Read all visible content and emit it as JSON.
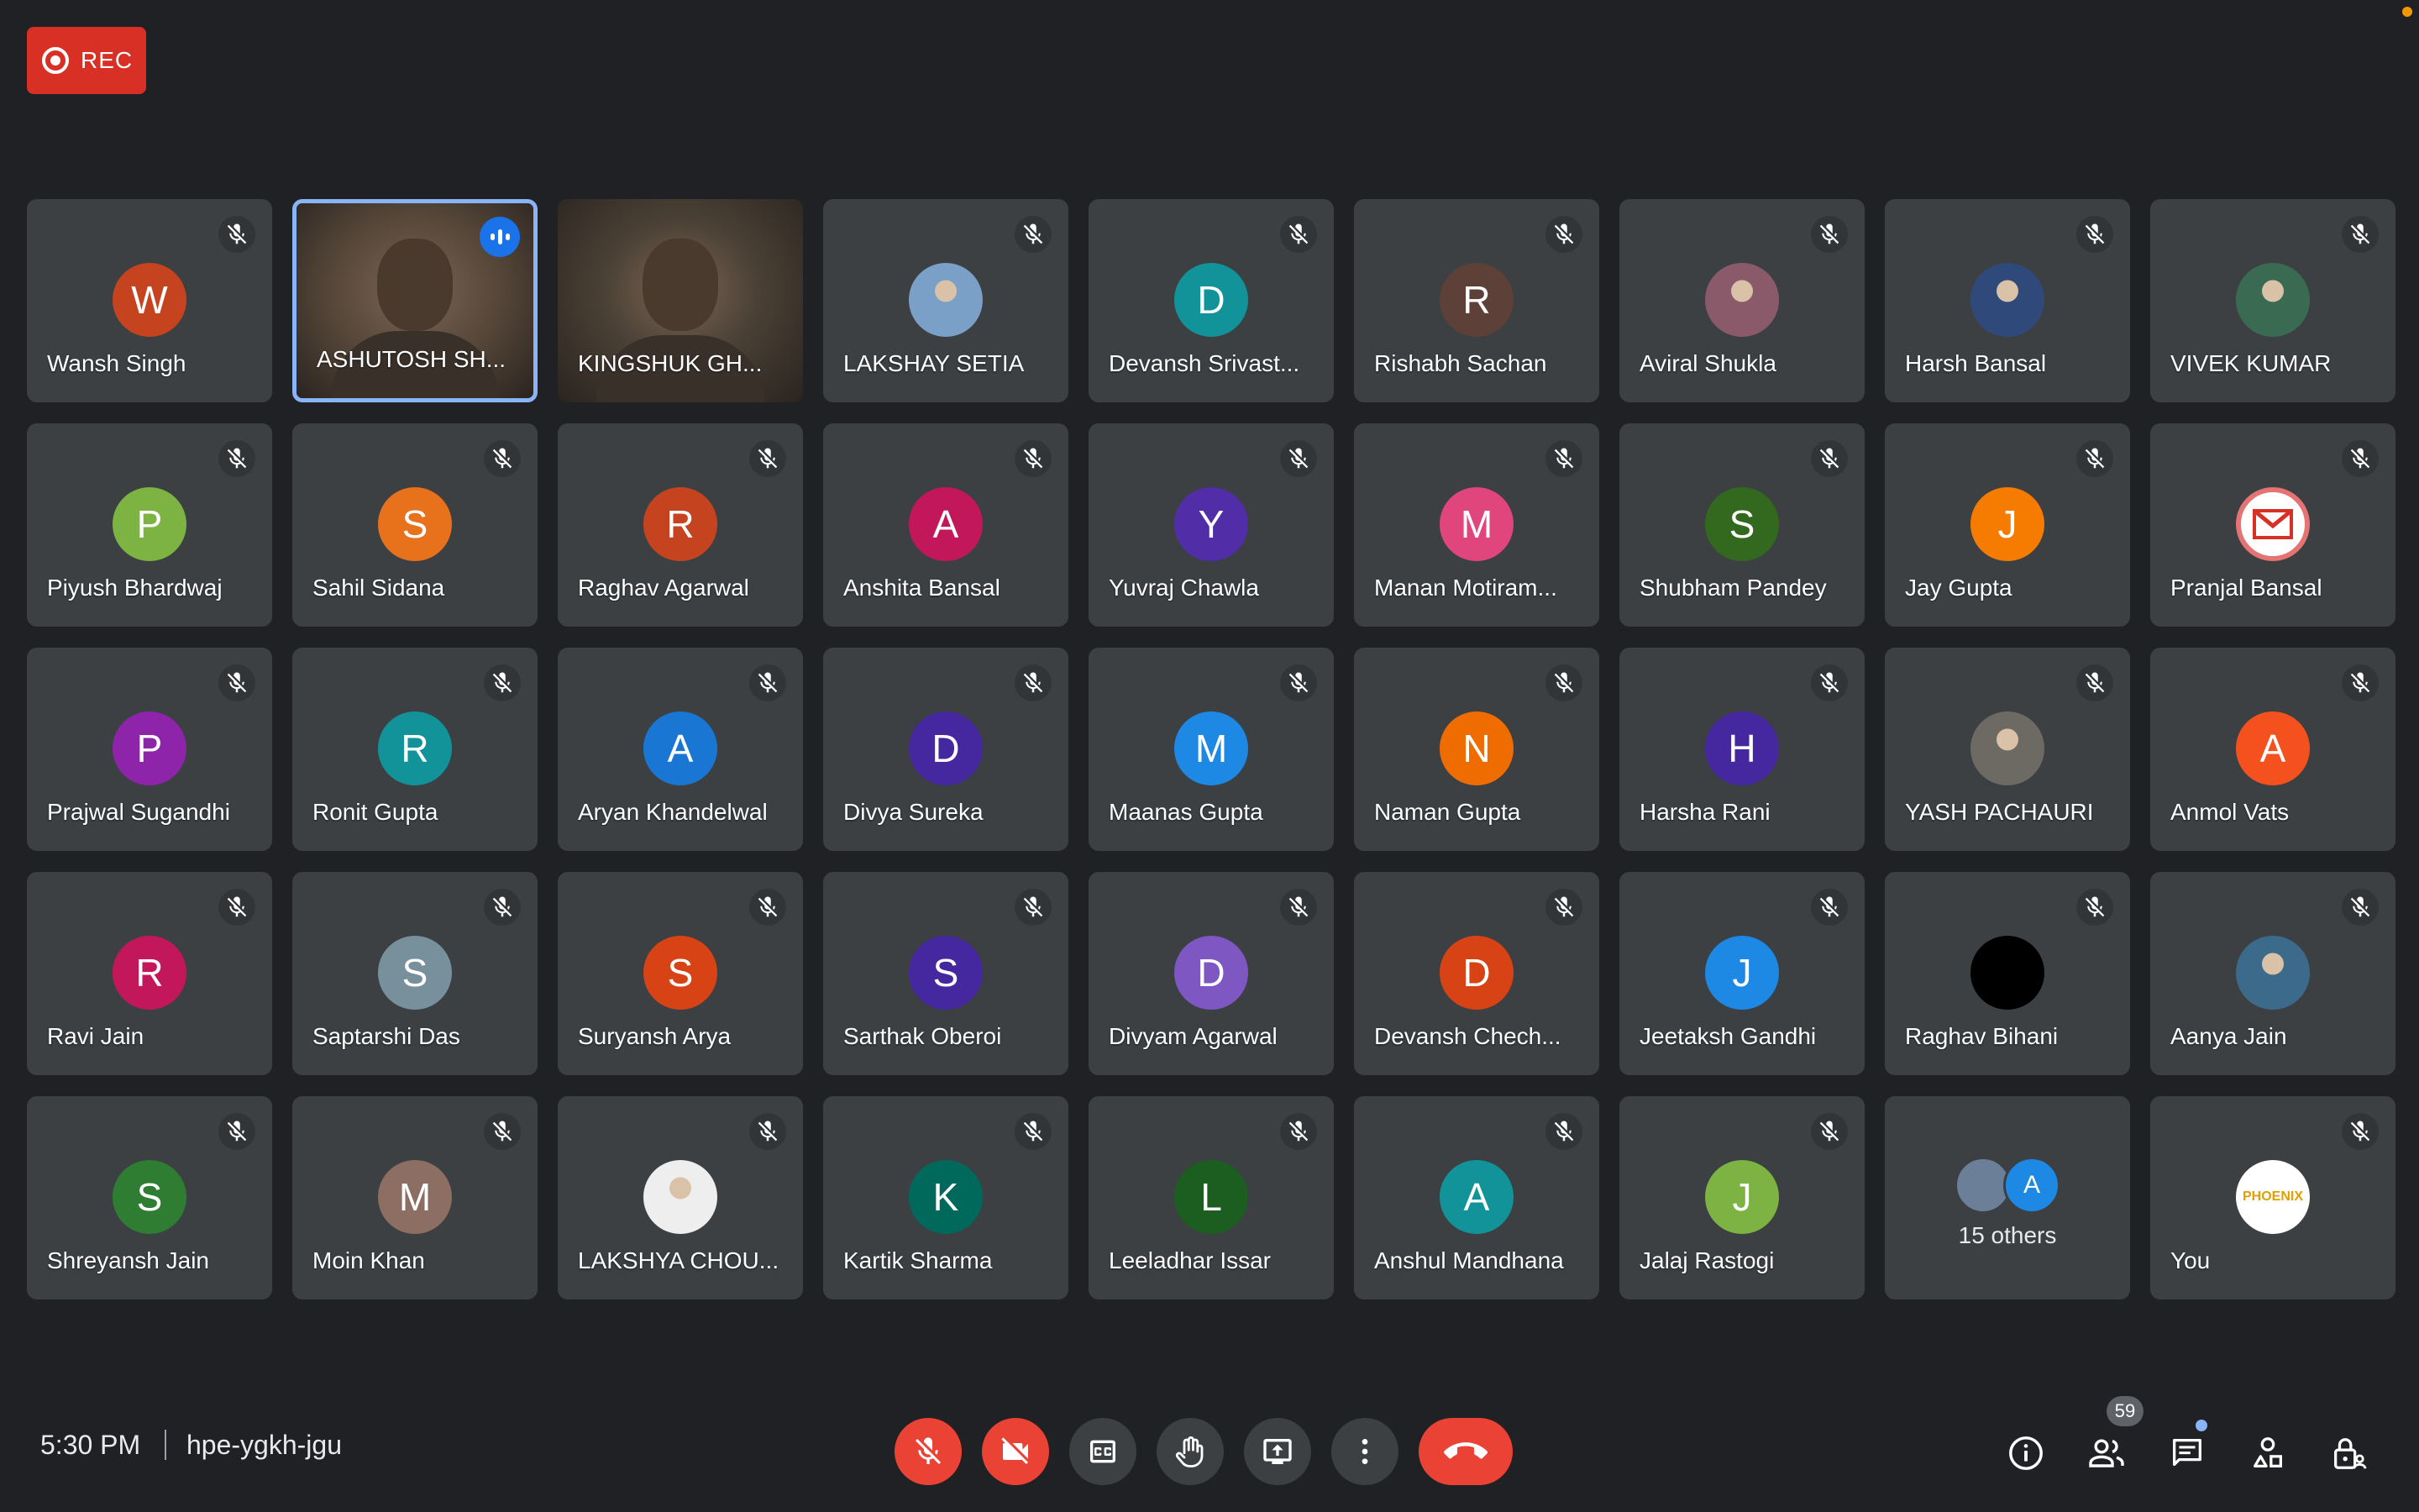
{
  "recording": {
    "label": "REC"
  },
  "participants": [
    {
      "name": "Wansh Singh",
      "initial": "W",
      "color": "#c5441f",
      "type": "letter"
    },
    {
      "name": "ASHUTOSH SH...",
      "initial": "",
      "color": "#5a4a3c",
      "type": "video",
      "speaking": true
    },
    {
      "name": "KINGSHUK GH...",
      "initial": "",
      "color": "#4a4035",
      "type": "video"
    },
    {
      "name": "LAKSHAY SETIA",
      "initial": "",
      "color": "#7aa0c8",
      "type": "photo"
    },
    {
      "name": "Devansh Srivast...",
      "initial": "D",
      "color": "#12939a",
      "type": "letter"
    },
    {
      "name": "Rishabh Sachan",
      "initial": "R",
      "color": "#5d4037",
      "type": "letter"
    },
    {
      "name": "Aviral Shukla",
      "initial": "",
      "color": "#8a5a6a",
      "type": "photo"
    },
    {
      "name": "Harsh Bansal",
      "initial": "",
      "color": "#2f4a7a",
      "type": "photo"
    },
    {
      "name": "VIVEK KUMAR",
      "initial": "",
      "color": "#3a6a52",
      "type": "photo"
    },
    {
      "name": "Piyush Bhardwaj",
      "initial": "P",
      "color": "#7cb342",
      "type": "letter"
    },
    {
      "name": "Sahil Sidana",
      "initial": "S",
      "color": "#e8711c",
      "type": "letter"
    },
    {
      "name": "Raghav Agarwal",
      "initial": "R",
      "color": "#c5441f",
      "type": "letter"
    },
    {
      "name": "Anshita Bansal",
      "initial": "A",
      "color": "#c2185b",
      "type": "letter"
    },
    {
      "name": "Yuvraj Chawla",
      "initial": "Y",
      "color": "#512da8",
      "type": "letter"
    },
    {
      "name": "Manan Motiram...",
      "initial": "M",
      "color": "#e0457b",
      "type": "letter"
    },
    {
      "name": "Shubham Pandey",
      "initial": "S",
      "color": "#33691e",
      "type": "letter"
    },
    {
      "name": "Jay Gupta",
      "initial": "J",
      "color": "#f57c00",
      "type": "letter"
    },
    {
      "name": "Pranjal Bansal",
      "initial": "",
      "color": "#e57373",
      "type": "gmail"
    },
    {
      "name": "Prajwal Sugandhi",
      "initial": "P",
      "color": "#8e24aa",
      "type": "letter"
    },
    {
      "name": "Ronit Gupta",
      "initial": "R",
      "color": "#12939a",
      "type": "letter"
    },
    {
      "name": "Aryan Khandelwal",
      "initial": "A",
      "color": "#1976d2",
      "type": "letter"
    },
    {
      "name": "Divya Sureka",
      "initial": "D",
      "color": "#4527a0",
      "type": "letter"
    },
    {
      "name": "Maanas Gupta",
      "initial": "M",
      "color": "#1e88e5",
      "type": "letter"
    },
    {
      "name": "Naman Gupta",
      "initial": "N",
      "color": "#ef6c00",
      "type": "letter"
    },
    {
      "name": "Harsha Rani",
      "initial": "H",
      "color": "#4527a0",
      "type": "letter"
    },
    {
      "name": "YASH PACHAURI",
      "initial": "",
      "color": "#6d6a64",
      "type": "photo"
    },
    {
      "name": "Anmol Vats",
      "initial": "A",
      "color": "#f4511e",
      "type": "letter"
    },
    {
      "name": "Ravi Jain",
      "initial": "R",
      "color": "#c2185b",
      "type": "letter"
    },
    {
      "name": "Saptarshi Das",
      "initial": "S",
      "color": "#78909c",
      "type": "letter"
    },
    {
      "name": "Suryansh Arya",
      "initial": "S",
      "color": "#d84315",
      "type": "letter"
    },
    {
      "name": "Sarthak Oberoi",
      "initial": "S",
      "color": "#4527a0",
      "type": "letter"
    },
    {
      "name": "Divyam Agarwal",
      "initial": "D",
      "color": "#7e57c2",
      "type": "letter"
    },
    {
      "name": "Devansh Chech...",
      "initial": "D",
      "color": "#d84315",
      "type": "letter"
    },
    {
      "name": "Jeetaksh Gandhi",
      "initial": "J",
      "color": "#1e88e5",
      "type": "letter"
    },
    {
      "name": "Raghav Bihani",
      "initial": "",
      "color": "#000000",
      "type": "blank"
    },
    {
      "name": "Aanya Jain",
      "initial": "",
      "color": "#3b6a8a",
      "type": "photo"
    },
    {
      "name": "Shreyansh Jain",
      "initial": "S",
      "color": "#2e7d32",
      "type": "letter"
    },
    {
      "name": "Moin Khan",
      "initial": "M",
      "color": "#8d6e63",
      "type": "letter"
    },
    {
      "name": "LAKSHYA CHOU...",
      "initial": "",
      "color": "#eeeeee",
      "type": "photo"
    },
    {
      "name": "Kartik Sharma",
      "initial": "K",
      "color": "#00695c",
      "type": "letter"
    },
    {
      "name": "Leeladhar Issar",
      "initial": "L",
      "color": "#1b5e20",
      "type": "letter"
    },
    {
      "name": "Anshul Mandhana",
      "initial": "A",
      "color": "#12939a",
      "type": "letter"
    },
    {
      "name": "Jalaj Rastogi",
      "initial": "J",
      "color": "#7cb342",
      "type": "letter"
    },
    {
      "name": "",
      "initial": "",
      "color": "",
      "type": "others"
    },
    {
      "name": "You",
      "initial": "",
      "color": "#ffffff",
      "type": "self"
    }
  ],
  "others": {
    "label": "15 others",
    "avatar_initial": "A",
    "avatar_color": "#1e88e5"
  },
  "self_avatar_text": "PHOENIX",
  "footer": {
    "time": "5:30 PM",
    "meeting_code": "hpe-ygkh-jgu",
    "participant_count": "59"
  }
}
